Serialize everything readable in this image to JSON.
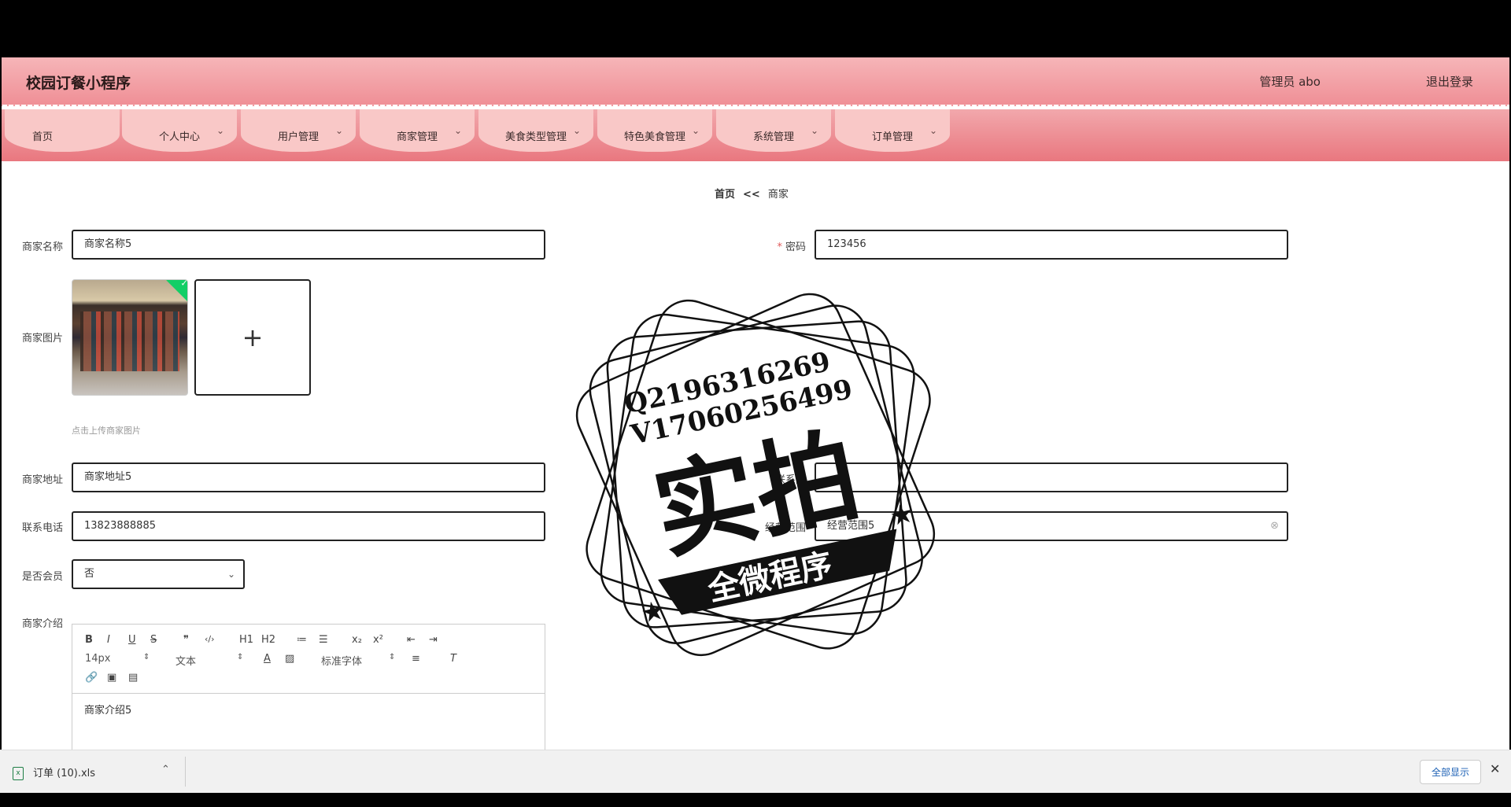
{
  "header": {
    "app_title": "校园订餐小程序",
    "user": "管理员 abo",
    "logout": "退出登录"
  },
  "nav": {
    "items": [
      {
        "label": "首页",
        "has_menu": false
      },
      {
        "label": "个人中心",
        "has_menu": true
      },
      {
        "label": "用户管理",
        "has_menu": true
      },
      {
        "label": "商家管理",
        "has_menu": true
      },
      {
        "label": "美食类型管理",
        "has_menu": true
      },
      {
        "label": "特色美食管理",
        "has_menu": true
      },
      {
        "label": "系统管理",
        "has_menu": true
      },
      {
        "label": "订单管理",
        "has_menu": true
      }
    ]
  },
  "breadcrumb": {
    "home": "首页",
    "separator": "<<",
    "current": "商家"
  },
  "form": {
    "name_label": "商家名称",
    "name_value": "商家名称5",
    "password_label": "密码",
    "password_value": "123456",
    "image_label": "商家图片",
    "image_hint": "点击上传商家图片",
    "upload_plus": "+",
    "address_label": "商家地址",
    "address_value": "商家地址5",
    "contact_label": "联系人",
    "contact_value": "",
    "phone_label": "联系电话",
    "phone_value": "13823888885",
    "scope_label": "经营范围",
    "scope_value": "经营范围5",
    "member_label": "是否会员",
    "member_value": "否",
    "intro_label": "商家介绍",
    "intro_value": "商家介绍5"
  },
  "editor": {
    "row1": [
      "B",
      "I",
      "U",
      "S",
      "❞",
      "‹/›",
      "H1",
      "H2",
      "≔",
      "☰",
      "x₂",
      "x²",
      "⇤",
      "⇥"
    ],
    "font_size": "14px",
    "text_style": "文本",
    "font_family": "标准字体",
    "row3": [
      "🔗",
      "▣",
      "▤"
    ]
  },
  "watermark": {
    "line1": "Q2196316269",
    "line2": "V17060256499",
    "big": "实拍",
    "ribbon": "全微程序"
  },
  "download_bar": {
    "file": "订单 (10).xls",
    "show_all": "全部显示",
    "close": "✕"
  },
  "colors": {
    "header_top": "#f6b5b8",
    "header_bottom": "#ef8e95",
    "nav_tab": "#f9c8c7",
    "required": "#e05a5a"
  }
}
